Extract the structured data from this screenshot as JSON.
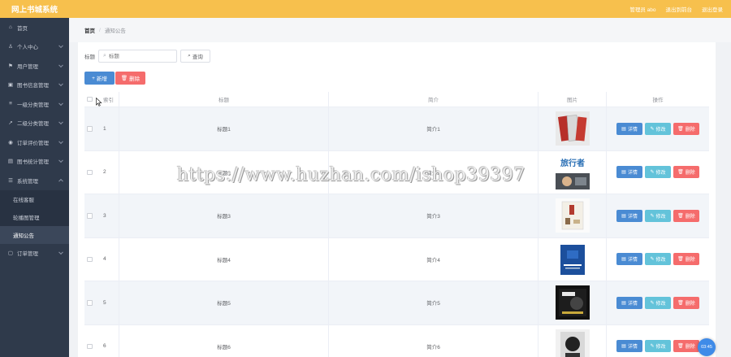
{
  "app": {
    "title": "网上书城系统"
  },
  "top_links": [
    "管理员 abo",
    "退出到前台",
    "退出登录"
  ],
  "sidebar": {
    "items": [
      {
        "icon": "home-icon",
        "glyph": "⌂",
        "label": "首页",
        "chevron": false
      },
      {
        "icon": "user-icon",
        "glyph": "♙",
        "label": "个人中心",
        "chevron": true
      },
      {
        "icon": "flag-icon",
        "glyph": "⚑",
        "label": "用户管理",
        "chevron": true
      },
      {
        "icon": "book-icon",
        "glyph": "▣",
        "label": "图书信息管理",
        "chevron": true
      },
      {
        "icon": "list-icon",
        "glyph": "≡",
        "label": "一级分类管理",
        "chevron": true
      },
      {
        "icon": "send-icon",
        "glyph": "↗",
        "label": "二级分类管理",
        "chevron": true
      },
      {
        "icon": "location-icon",
        "glyph": "◉",
        "label": "订单评价管理",
        "chevron": true
      },
      {
        "icon": "chart-icon",
        "glyph": "▤",
        "label": "图书统计管理",
        "chevron": true
      },
      {
        "icon": "settings-icon",
        "glyph": "☰",
        "label": "系统管理",
        "chevron": true,
        "open": true
      }
    ],
    "subitems": [
      "在线客服",
      "轮播图管理",
      "通知公告"
    ],
    "active_sub": 2,
    "after": [
      {
        "icon": "order-icon",
        "glyph": "▢",
        "label": "订单管理",
        "chevron": true
      }
    ]
  },
  "breadcrumb": {
    "home": "首页",
    "sep": "/",
    "current": "通知公告"
  },
  "search": {
    "label": "标题",
    "placeholder": "标题",
    "button": "查询"
  },
  "actions": {
    "add": "新增",
    "delete": "删除"
  },
  "table": {
    "headers": {
      "index": "索引",
      "title": "标题",
      "intro": "简介",
      "image": "图片",
      "ops": "操作"
    },
    "op_labels": {
      "detail": "详情",
      "edit": "修改",
      "delete": "删除"
    },
    "rows": [
      {
        "index": "1",
        "title": "标题1",
        "intro": "简介1",
        "image": "book-cover-1"
      },
      {
        "index": "2",
        "title": "标题2",
        "intro": "简介2",
        "image": "book-cover-2"
      },
      {
        "index": "3",
        "title": "标题3",
        "intro": "简介3",
        "image": "book-cover-3"
      },
      {
        "index": "4",
        "title": "标题4",
        "intro": "简介4",
        "image": "book-cover-4"
      },
      {
        "index": "5",
        "title": "标题5",
        "intro": "简介5",
        "image": "book-cover-5"
      },
      {
        "index": "6",
        "title": "标题6",
        "intro": "简介6",
        "image": "book-cover-6"
      }
    ]
  },
  "watermark": "https://www.huzhan.com/ishop39397",
  "clock": "03:45",
  "colors": {
    "topbar": "#f7c04d",
    "sidebar": "#2f3a4b",
    "primary": "#4a8bd3",
    "danger": "#f56c6c",
    "info": "#63c3da"
  }
}
